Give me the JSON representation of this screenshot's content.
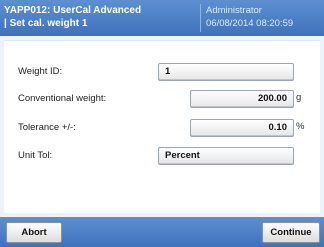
{
  "header": {
    "app_line1": "YAPP012: UserCal Advanced",
    "app_line2": "| Set cal. weight 1",
    "user": "Administrator",
    "datetime": "06/08/2014 08:20:59"
  },
  "form": {
    "weight_id": {
      "label": "Weight ID:",
      "value": "1"
    },
    "conventional_weight": {
      "label": "Conventional weight:",
      "value": "200.00",
      "unit": "g"
    },
    "tolerance": {
      "label": "Tolerance +/-:",
      "value": "0.10",
      "unit": "%"
    },
    "unit_tol": {
      "label": "Unit Tol:",
      "value": "Percent"
    }
  },
  "footer": {
    "abort_label": "Abort",
    "continue_label": "Continue"
  },
  "colors": {
    "header_bg": "#4a7fc6",
    "panel_bg": "#ffffff",
    "screen_bg": "#eef3f9"
  }
}
